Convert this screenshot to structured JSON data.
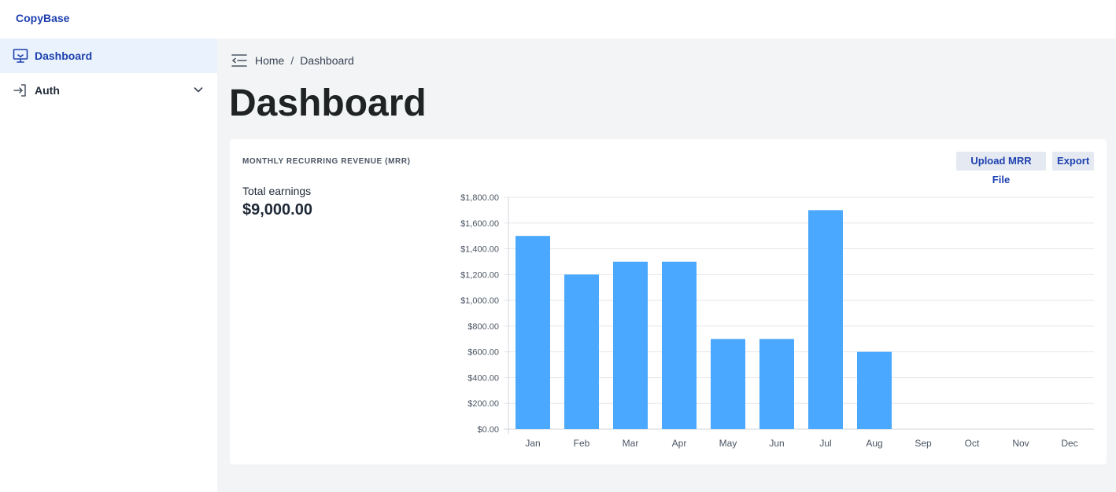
{
  "app": {
    "brand": "CopyBase"
  },
  "sidebar": {
    "items": [
      {
        "label": "Dashboard",
        "icon": "monitor-icon",
        "active": true
      },
      {
        "label": "Auth",
        "icon": "sign-in-icon",
        "expandable": true
      }
    ]
  },
  "breadcrumb": {
    "home": "Home",
    "separator": "/",
    "current": "Dashboard"
  },
  "page": {
    "title": "Dashboard"
  },
  "card": {
    "title": "MONTHLY RECURRING REVENUE (MRR)",
    "upload_label": "Upload MRR File",
    "export_label": "Export",
    "earnings_label": "Total earnings",
    "earnings_value": "$9,000.00"
  },
  "colors": {
    "accent": "#1e40af",
    "bar": "#4aa8ff",
    "active_bg": "#eaf3fd"
  },
  "chart_data": {
    "type": "bar",
    "categories": [
      "Jan",
      "Feb",
      "Mar",
      "Apr",
      "May",
      "Jun",
      "Jul",
      "Aug",
      "Sep",
      "Oct",
      "Nov",
      "Dec"
    ],
    "values": [
      1500,
      1200,
      1300,
      1300,
      700,
      700,
      1700,
      600,
      0,
      0,
      0,
      0
    ],
    "ylim": [
      0,
      1800
    ],
    "yticks": [
      0,
      200,
      400,
      600,
      800,
      1000,
      1200,
      1400,
      1600,
      1800
    ],
    "ytick_labels": [
      "$0.00",
      "$200.00",
      "$400.00",
      "$600.00",
      "$800.00",
      "$1,000.00",
      "$1,200.00",
      "$1,400.00",
      "$1,600.00",
      "$1,800.00"
    ],
    "grid": true,
    "color": "#4aa8ff"
  }
}
